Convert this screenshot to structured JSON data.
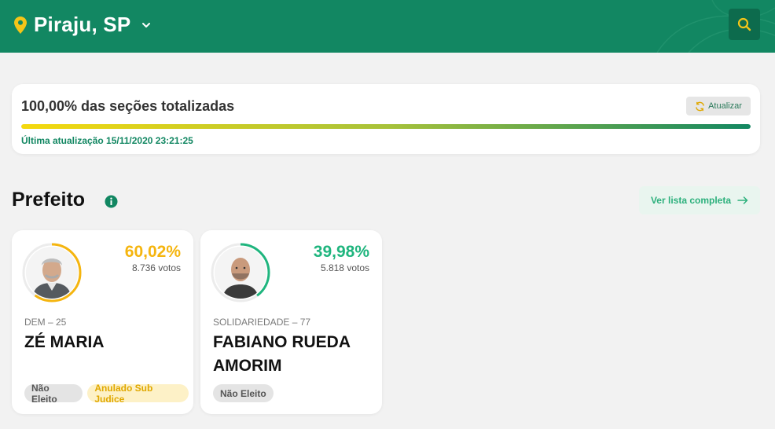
{
  "header": {
    "city": "Piraju, SP",
    "pin_icon": "location-pin-icon",
    "chevron_icon": "chevron-down-icon",
    "search_icon": "search-icon",
    "bg_color": "#128762",
    "accent_color": "#f5c518"
  },
  "progress": {
    "title": "100,00% das seções totalizadas",
    "percent": 100,
    "refresh_label": "Atualizar",
    "refresh_icon": "refresh-icon",
    "last_update": "Última atualização 15/11/2020 23:21:25"
  },
  "section": {
    "title": "Prefeito",
    "info_icon": "info-icon",
    "full_list_label": "Ver lista completa",
    "arrow_icon": "arrow-right-icon"
  },
  "candidates": [
    {
      "percent_text": "60,02%",
      "percent": 60.02,
      "votes": "8.736 votos",
      "party": "DEM – 25",
      "name": "ZÉ MARIA",
      "color": "#f5b50f",
      "badges": [
        "Não Eleito",
        "Anulado Sub Judice"
      ]
    },
    {
      "percent_text": "39,98%",
      "percent": 39.98,
      "votes": "5.818 votos",
      "party": "SOLIDARIEDADE – 77",
      "name": "FABIANO RUEDA AMORIM",
      "color": "#1fb57e",
      "badges": [
        "Não Eleito"
      ]
    }
  ]
}
